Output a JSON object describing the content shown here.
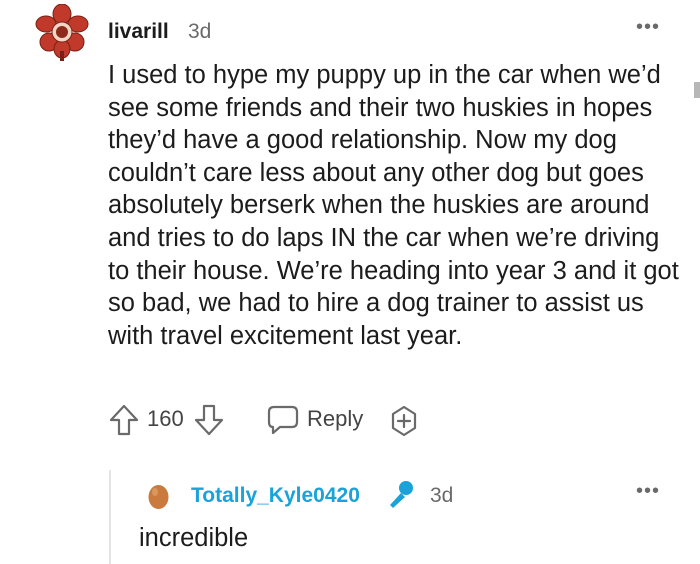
{
  "comment": {
    "username": "livarill",
    "age": "3d",
    "more_glyph": "•••",
    "body": "I used to hype my puppy up in the car when we’d see some friends and their two huskies in hopes they’d have a good relationship. Now my dog couldn’t care less about any other dog but goes absolutely berserk when the huskies are around and tries to do laps IN the car when we’re driving to their house. We’re heading into year 3 and it got so bad, we had to hire a dog trainer to assist us with travel excitement last year.",
    "score": "160",
    "reply_label": "Reply"
  },
  "reply": {
    "username": "Totally_Kyle0420",
    "age": "3d",
    "more_glyph": "•••",
    "body": "incredible"
  },
  "icons": {
    "avatar1": "flower-monster-avatar",
    "upvote": "arrow-up-icon",
    "downvote": "arrow-down-icon",
    "reply": "speech-bubble-icon",
    "award": "award-plus-icon",
    "avatar2": "egg-avatar",
    "mic": "microphone-icon"
  },
  "colors": {
    "text": "#1c1c1c",
    "muted": "#6a6a6a",
    "reply_username": "#1aa2d9",
    "mic": "#1aa2d9",
    "avatar_red": "#c0392b",
    "egg": "#c97a3c"
  }
}
